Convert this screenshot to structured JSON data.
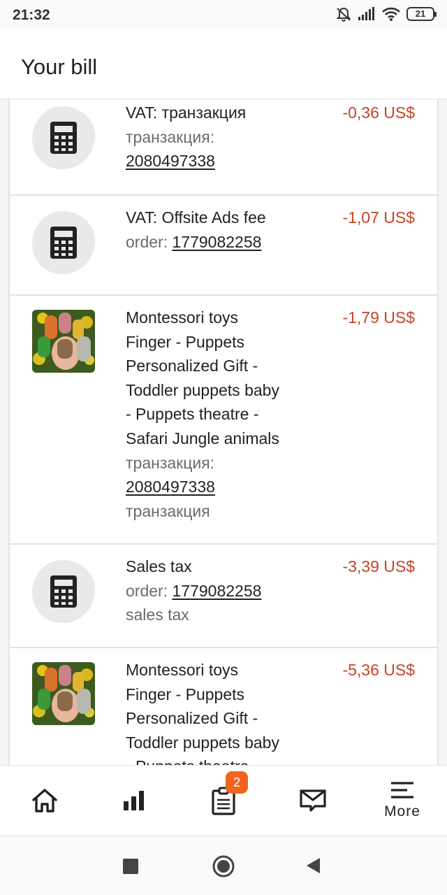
{
  "status_bar": {
    "time": "21:32",
    "battery": "21"
  },
  "header": {
    "title": "Your bill"
  },
  "rows": [
    {
      "title": "VAT: транзакция",
      "ref_label": "транзакция:",
      "ref_value": "2080497338",
      "amount": "-0,36 US$",
      "icon": "calculator-icon"
    },
    {
      "title": "VAT: Offsite Ads fee",
      "ref_label": "order:",
      "ref_value": "1779082258",
      "amount": "-1,07 US$",
      "icon": "calculator-icon"
    },
    {
      "title_lines": [
        "Montessori toys",
        "Finger - Puppets",
        "Personalized Gift -",
        "Toddler puppets baby",
        "- Puppets theatre -",
        "Safari Jungle animals"
      ],
      "ref_label": "транзакция:",
      "ref_value": "2080497338",
      "sub": "транзакция",
      "amount": "-1,79 US$",
      "icon": "product-thumbnail"
    },
    {
      "title": "Sales tax",
      "ref_label": "order:",
      "ref_value": "1779082258",
      "sub": "sales tax",
      "amount": "-3,39 US$",
      "icon": "calculator-icon"
    },
    {
      "title_lines": [
        "Montessori toys",
        "Finger - Puppets",
        "Personalized Gift -",
        "Toddler puppets baby",
        "- Puppets theatre -"
      ],
      "amount": "-5,36 US$",
      "icon": "product-thumbnail"
    }
  ],
  "bottom_nav": {
    "items": [
      {
        "icon": "home-icon"
      },
      {
        "icon": "stats-icon"
      },
      {
        "icon": "orders-icon",
        "badge": "2"
      },
      {
        "icon": "messages-icon"
      },
      {
        "icon": "menu-icon",
        "label": "More"
      }
    ]
  },
  "colors": {
    "amount": "#c4442a",
    "badge": "#f1641e"
  }
}
